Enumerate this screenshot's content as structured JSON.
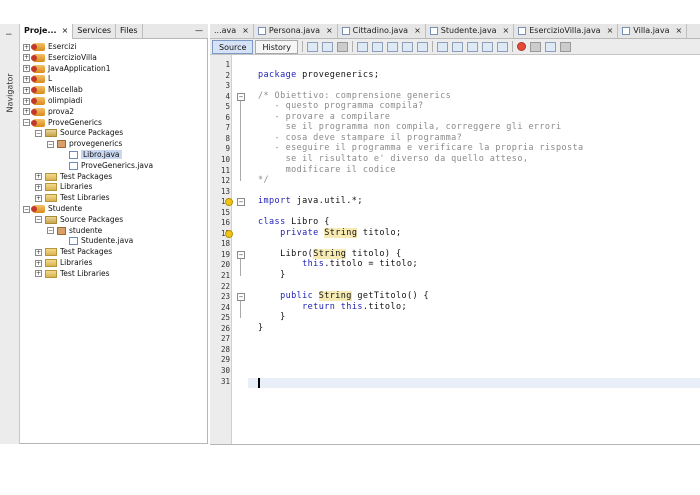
{
  "navigator_strip": {
    "minus": "−",
    "label": "Navigator"
  },
  "projects_panel": {
    "tabs": [
      {
        "label": "Proje...",
        "close": "×"
      },
      {
        "label": "Services"
      },
      {
        "label": "Files"
      }
    ],
    "minimize": "—",
    "tree": [
      {
        "text": "Esercizi",
        "indent": 0,
        "exp": "+",
        "icon": "project"
      },
      {
        "text": "EsercizioVilla",
        "indent": 0,
        "exp": "+",
        "icon": "project"
      },
      {
        "text": "JavaApplication1",
        "indent": 0,
        "exp": "+",
        "icon": "project"
      },
      {
        "text": "L",
        "indent": 0,
        "exp": "+",
        "icon": "project"
      },
      {
        "text": "Miscellab",
        "indent": 0,
        "exp": "+",
        "icon": "project"
      },
      {
        "text": "olimpiadi",
        "indent": 0,
        "exp": "+",
        "icon": "project"
      },
      {
        "text": "prova2",
        "indent": 0,
        "exp": "+",
        "icon": "project"
      },
      {
        "text": "ProveGenerics",
        "indent": 0,
        "exp": "−",
        "icon": "project"
      },
      {
        "text": "Source Packages",
        "indent": 1,
        "exp": "−",
        "icon": "package"
      },
      {
        "text": "provegenerics",
        "indent": 2,
        "exp": "−",
        "icon": "pkg"
      },
      {
        "text": "Libro.java",
        "indent": 3,
        "exp": "",
        "icon": "java",
        "selected": true
      },
      {
        "text": "ProveGenerics.java",
        "indent": 3,
        "exp": "",
        "icon": "java"
      },
      {
        "text": "Test Packages",
        "indent": 1,
        "exp": "+",
        "icon": "folder"
      },
      {
        "text": "Libraries",
        "indent": 1,
        "exp": "+",
        "icon": "folder"
      },
      {
        "text": "Test Libraries",
        "indent": 1,
        "exp": "+",
        "icon": "folder"
      },
      {
        "text": "Studente",
        "indent": 0,
        "exp": "−",
        "icon": "project"
      },
      {
        "text": "Source Packages",
        "indent": 1,
        "exp": "−",
        "icon": "package"
      },
      {
        "text": "studente",
        "indent": 2,
        "exp": "−",
        "icon": "pkg"
      },
      {
        "text": "Studente.java",
        "indent": 3,
        "exp": "",
        "icon": "java"
      },
      {
        "text": "Test Packages",
        "indent": 1,
        "exp": "+",
        "icon": "folder"
      },
      {
        "text": "Libraries",
        "indent": 1,
        "exp": "+",
        "icon": "folder"
      },
      {
        "text": "Test Libraries",
        "indent": 1,
        "exp": "+",
        "icon": "folder"
      }
    ]
  },
  "editor": {
    "tabs": [
      {
        "label": "...ava",
        "icon": false
      },
      {
        "label": "Persona.java",
        "icon": true
      },
      {
        "label": "Cittadino.java",
        "icon": true
      },
      {
        "label": "Studente.java",
        "icon": true
      },
      {
        "label": "EsercizioVilla.java",
        "icon": true
      },
      {
        "label": "Villa.java",
        "icon": true
      }
    ],
    "close_glyph": "×",
    "toolbar": {
      "source": "Source",
      "history": "History"
    },
    "line_count": 31,
    "lines": [
      {
        "n": 2,
        "text": "package provegenerics;"
      },
      {
        "n": 4,
        "text": "/* Obiettivo: comprensione generics"
      },
      {
        "n": 5,
        "text": "   - questo programma compila?"
      },
      {
        "n": 6,
        "text": "   - provare a compilare"
      },
      {
        "n": 7,
        "text": "     se il programma non compila, correggere gli errori"
      },
      {
        "n": 8,
        "text": "   - cosa deve stampare il programma?"
      },
      {
        "n": 9,
        "text": "   - eseguire il programma e verificare la propria risposta"
      },
      {
        "n": 10,
        "text": "     se il risultato e' diverso da quello atteso,"
      },
      {
        "n": 11,
        "text": "     modificare il codice"
      },
      {
        "n": 12,
        "text": "*/"
      },
      {
        "n": 14,
        "text": "import java.util.*;"
      },
      {
        "n": 16,
        "text": "class Libro {"
      },
      {
        "n": 17,
        "text": "    private String titolo;"
      },
      {
        "n": 19,
        "text": "    Libro(String titolo) {"
      },
      {
        "n": 20,
        "text": "        this.titolo = titolo;"
      },
      {
        "n": 21,
        "text": "    }"
      },
      {
        "n": 23,
        "text": "    public String getTitolo() {"
      },
      {
        "n": 24,
        "text": "        return this.titolo;"
      },
      {
        "n": 25,
        "text": "    }"
      },
      {
        "n": 26,
        "text": "}"
      }
    ]
  }
}
